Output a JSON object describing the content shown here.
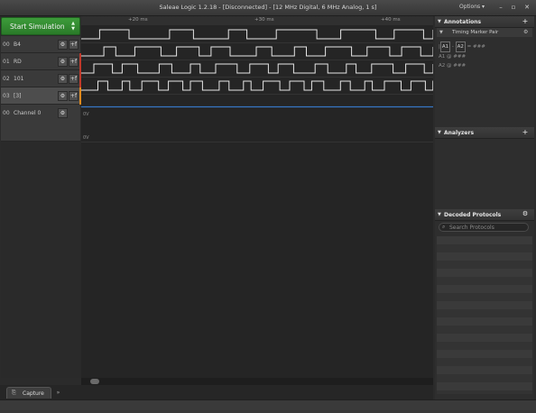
{
  "window": {
    "title": "Saleae Logic 1.2.18 - [Disconnected] - [12 MHz Digital, 6 MHz Analog, 1 s]",
    "options_label": "Options ▾",
    "minimize": "–",
    "restore": "▫",
    "close": "✕"
  },
  "toolbar": {
    "start_label": "Start Simulation",
    "spinner": "▲\n▼"
  },
  "ruler": {
    "ticks": [
      "+20 ms",
      "+30 ms",
      "+40 ms"
    ]
  },
  "channels": [
    {
      "num": "00",
      "name": "B4",
      "edge_color": "#2a2a2a"
    },
    {
      "num": "01",
      "name": "RD",
      "edge_color": "#c0392b"
    },
    {
      "num": "02",
      "name": "101",
      "edge_color": "#c0392b"
    },
    {
      "num": "03",
      "name": "[3]",
      "edge_color": "#e08a1e"
    }
  ],
  "analog": {
    "num": "00",
    "name": "Channel 0"
  },
  "channel_buttons": {
    "gear": "⚙",
    "edge": "+f"
  },
  "wave_labels": {
    "analog_top": "0V",
    "analog_bottom": "0V"
  },
  "colors": {
    "wave": "#e6e6e6",
    "analog": "#3a7fd6",
    "accent_green": "#2f8a2d"
  },
  "annotations": {
    "title": "Annotations",
    "add": "+",
    "marker_pair": "Timing Marker Pair",
    "formula": {
      "a1": "A1",
      "minus": "-",
      "a2": "A2",
      "eq": "= ###"
    },
    "lines": [
      "A1  @  ###",
      "A2  @  ###"
    ]
  },
  "analyzers": {
    "title": "Analyzers",
    "add": "+"
  },
  "decoded": {
    "title": "Decoded Protocols",
    "search_placeholder": "Search Protocols"
  },
  "bottom": {
    "capture_label": "Capture",
    "more": "»"
  }
}
